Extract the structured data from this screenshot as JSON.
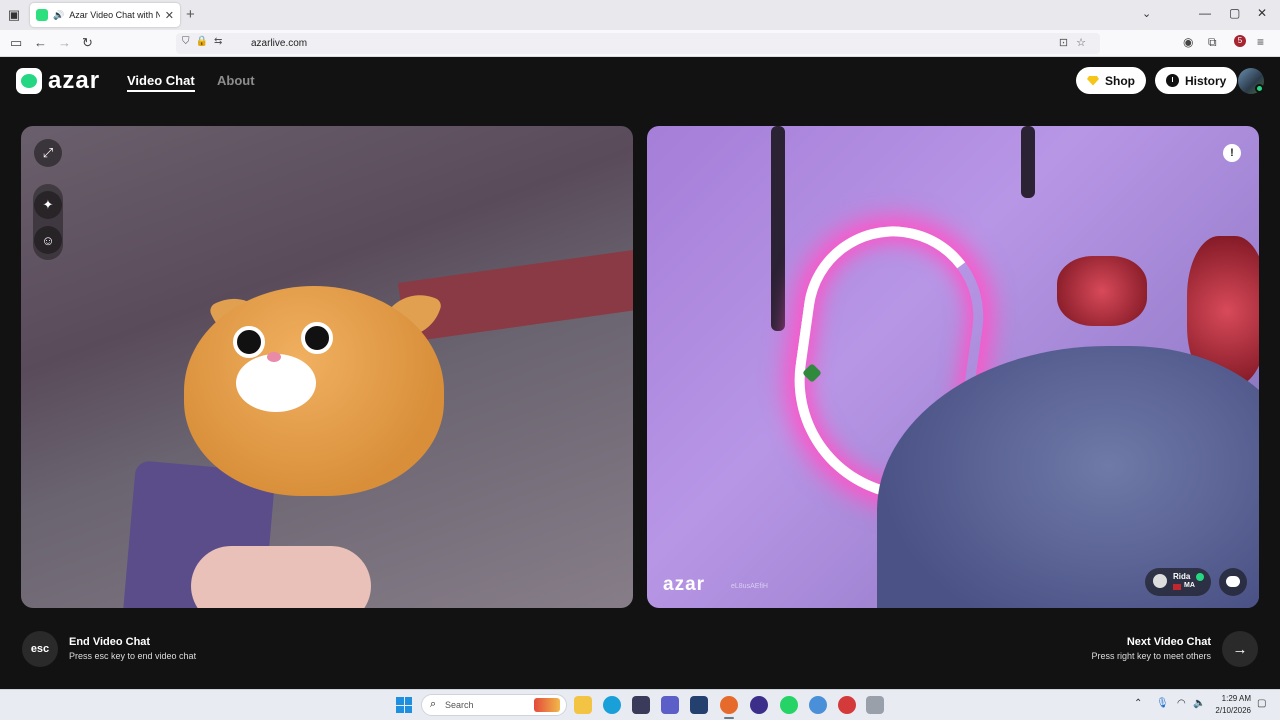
{
  "browser": {
    "tab_title": "Azar Video Chat with New",
    "url": "azarlive.com",
    "extension_badge": "5"
  },
  "header": {
    "logo_text": "azar",
    "nav": [
      {
        "label": "Video Chat",
        "active": true
      },
      {
        "label": "About",
        "active": false
      }
    ],
    "shop_label": "Shop",
    "history_label": "History"
  },
  "remote": {
    "watermark": "azar",
    "watermark_id": "eL8usAEfiH",
    "peer_name": "Rida",
    "peer_country": "MA"
  },
  "footer": {
    "esc_key": "esc",
    "end_title": "End Video Chat",
    "end_sub": "Press esc key to end video chat",
    "next_title": "Next Video Chat",
    "next_sub": "Press right key to meet others"
  },
  "taskbar": {
    "search_placeholder": "Search",
    "time": "1:29 AM",
    "date": "2/10/2026"
  },
  "colors": {
    "accent": "#25d783",
    "page_bg": "#121212",
    "pill_bg": "#ffffff"
  },
  "icons": {
    "fullscreen": "expand-icon",
    "effects": "magic-wand-icon",
    "sticker": "smiley-icon",
    "report": "report-icon",
    "chat": "chat-bubble-icon",
    "next": "arrow-right-icon"
  }
}
